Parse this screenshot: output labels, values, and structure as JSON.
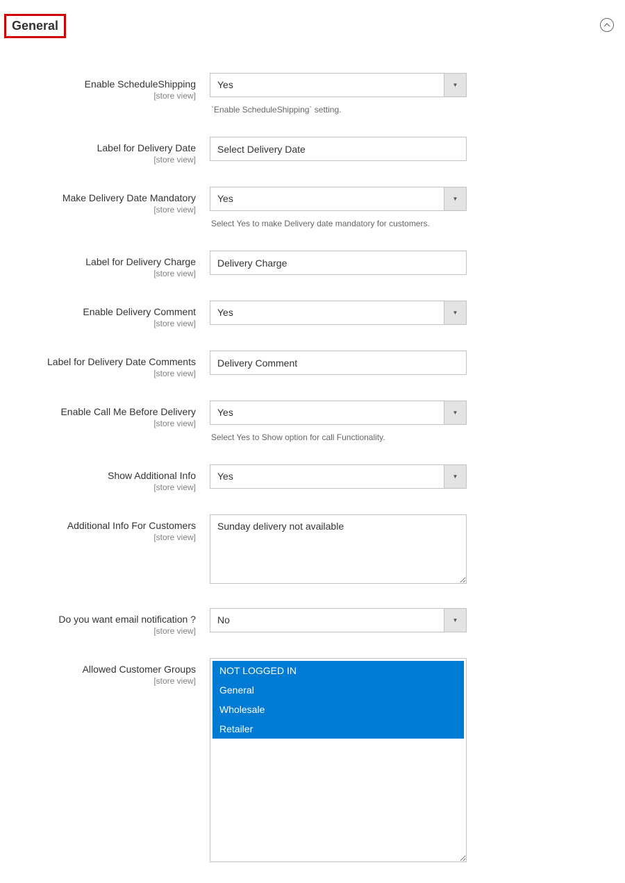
{
  "section": {
    "title": "General",
    "scope_label": "[store view]"
  },
  "fields": {
    "enable_schedule": {
      "label": "Enable ScheduleShipping",
      "value": "Yes",
      "help": "`Enable ScheduleShipping` setting."
    },
    "label_delivery_date": {
      "label": "Label for Delivery Date",
      "value": "Select Delivery Date"
    },
    "make_mandatory": {
      "label": "Make Delivery Date Mandatory",
      "value": "Yes",
      "help": "Select Yes to make Delivery date mandatory for customers."
    },
    "label_delivery_charge": {
      "label": "Label for Delivery Charge",
      "value": "Delivery Charge"
    },
    "enable_comment": {
      "label": "Enable Delivery Comment",
      "value": "Yes"
    },
    "label_date_comments": {
      "label": "Label for Delivery Date Comments",
      "value": "Delivery Comment"
    },
    "enable_call": {
      "label": "Enable Call Me Before Delivery",
      "value": "Yes",
      "help": "Select Yes to Show option for call Functionality."
    },
    "show_additional": {
      "label": "Show Additional Info",
      "value": "Yes"
    },
    "additional_info": {
      "label": "Additional Info For Customers",
      "value": "Sunday delivery not available"
    },
    "email_notification": {
      "label": "Do you want email notification ?",
      "value": "No"
    },
    "allowed_groups": {
      "label": "Allowed Customer Groups",
      "options": [
        "NOT LOGGED IN",
        "General",
        "Wholesale",
        "Retailer"
      ]
    }
  }
}
